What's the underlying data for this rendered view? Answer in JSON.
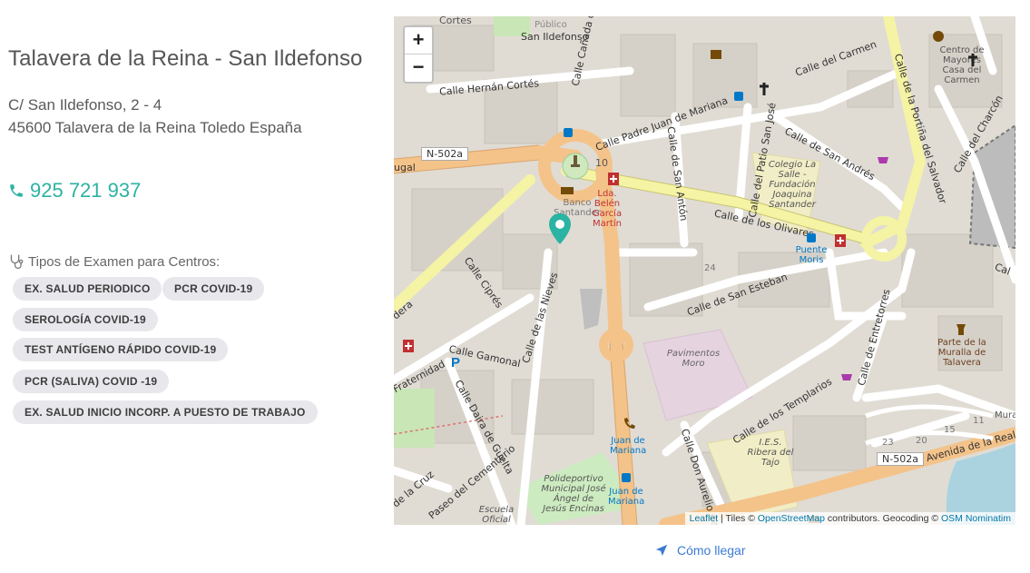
{
  "location": {
    "title": "Talavera de la Reina - San Ildefonso",
    "address_line1": "C/ San Ildefonso, 2 - 4",
    "address_line2": "45600 Talavera de la Reina Toledo España",
    "phone": "925 721 937"
  },
  "exams": {
    "heading": "Tipos de Examen para Centros:",
    "items": [
      "EX. SALUD PERIODICO",
      "PCR COVID-19",
      "SEROLOGÍA COVID-19",
      "TEST ANTÍGENO RÁPIDO COVID-19",
      "PCR (SALIVA) COVID -19",
      "EX. SALUD INICIO  INCORP. A PUESTO DE TRABAJO"
    ]
  },
  "map": {
    "zoom_in": "+",
    "zoom_out": "−",
    "attribution": {
      "leaflet": "Leaflet",
      "tiles_prefix": " | Tiles © ",
      "osm": "OpenStreetMap",
      "mid": " contributors. Geocoding © ",
      "nominatim": "OSM Nominatim"
    },
    "streets": {
      "cortes": "Cortes",
      "hernan_cortes": "Calle Hernán Cortés",
      "canada_sierra": "Calle Cañada de la Sierra",
      "publico": "Público",
      "san_ildefonso": "San Ildefonso",
      "padre_juan": "Calle Padre Juan de Mariana",
      "carmen": "Calle del Carmen",
      "portina": "Calle de la Portiña del Salvador",
      "charcon": "Calle del Charcón",
      "san_andres": "Calle de San Andrés",
      "san_anton": "Calle de San Antón",
      "patio_san_jose": "Calle del Patio San José",
      "olivares": "Calle de los Olivares",
      "cipres": "Calle Ciprés",
      "nieves": "Calle de las Nieves",
      "san_esteban": "Calle de San Esteban",
      "gamonal": "Calle Gamonal",
      "fraternidad": "Fraternidad",
      "daira": "Calle Daira de Guelta",
      "templarios": "Calle de los Templarios",
      "entretorres": "Calle de Entretorres",
      "cementerio": "Paseo del Cementerio",
      "don_aurelio": "Calle Don Aurelio de",
      "avenida_real": "Avenida de la Real F",
      "la_cruz": "de la Cruz",
      "dera": "dera",
      "ugal": "ugal",
      "cal": "Cal"
    },
    "roads": {
      "n502a_west": "N-502a",
      "n502a_south": "N-502a",
      "ten": "10"
    },
    "pois": {
      "banco": "Banco Santander",
      "belen": "Lda. Belén García Martín",
      "colegio": "Colegio La Salle - Fundación Joaquina Santander",
      "puente": "Puente Moris",
      "centro": "Centro de Mayores Casa del Carmen",
      "pavimentos": "Pavimentos Moro",
      "ies": "I.E.S. Ribera del Tajo",
      "muralla": "Parte de la Muralla de Talavera",
      "juan1": "Juan de Mariana",
      "juan2": "Juan de Mariana",
      "polideportivo": "Polideportivo Municipal José Ángel de Jesús Encinas",
      "escuela": "Escuela Oficial",
      "mura": "Mura"
    },
    "numbers": [
      "24",
      "23",
      "20",
      "15",
      "11"
    ]
  },
  "directions": {
    "label": "Cómo llegar"
  },
  "colors": {
    "accent": "#2bb3a3",
    "link": "#3b7bd4",
    "chip_bg": "#e8e8ec"
  }
}
